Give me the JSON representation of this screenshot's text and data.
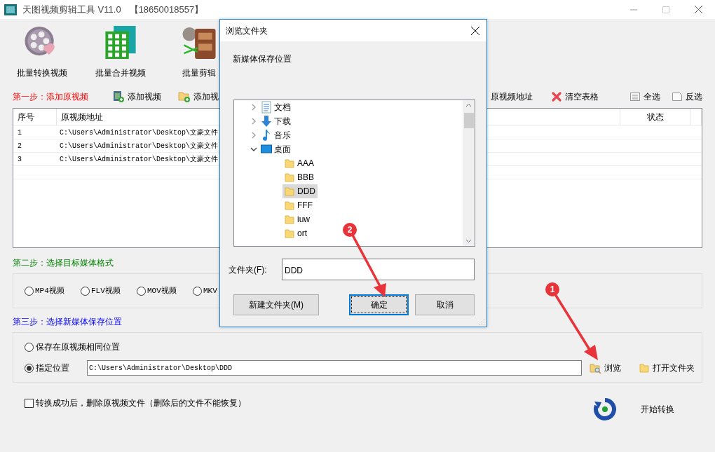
{
  "window": {
    "title": "天图视频剪辑工具 V11.0",
    "account": "【18650018557】"
  },
  "tools": [
    {
      "label": "批量转换视频",
      "kind": "convert"
    },
    {
      "label": "批量合并视频",
      "kind": "merge"
    },
    {
      "label": "批量剪辑",
      "kind": "cut"
    }
  ],
  "step1": {
    "label": "第一步：添加原视频",
    "actions_left": [
      {
        "label": "添加视频",
        "kind": "add-video"
      },
      {
        "label": "添加视",
        "kind": "add-folder"
      }
    ],
    "actions_right": [
      {
        "label": "原视频地址",
        "kind": "plain"
      },
      {
        "label": "清空表格",
        "kind": "clear"
      },
      {
        "label": "全选",
        "kind": "select-all"
      },
      {
        "label": "反选",
        "kind": "invert"
      }
    ]
  },
  "table": {
    "columns": [
      "序号",
      "原视频地址",
      "状态"
    ],
    "rows": [
      {
        "index": "1",
        "path": "C:\\Users\\Administrator\\Desktop\\文豪文件"
      },
      {
        "index": "2",
        "path": "C:\\Users\\Administrator\\Desktop\\文豪文件"
      },
      {
        "index": "3",
        "path": "C:\\Users\\Administrator\\Desktop\\文豪文件"
      }
    ]
  },
  "step2": {
    "label": "第二步：选择目标媒体格式",
    "formats": [
      {
        "label": "MP4视频",
        "selected": false
      },
      {
        "label": "FLV视频",
        "selected": false
      },
      {
        "label": "MOV视频",
        "selected": false
      },
      {
        "label": "MKV",
        "selected": false
      }
    ]
  },
  "step3": {
    "label": "第三步：选择新媒体保存位置",
    "options": [
      {
        "label": "保存在原视频相同位置",
        "selected": false
      },
      {
        "label": "指定位置",
        "selected": true
      }
    ],
    "path": "C:\\Users\\Administrator\\Desktop\\DDD",
    "browse": "浏览",
    "open_folder": "打开文件夹"
  },
  "delete_original": {
    "label": "转换成功后，删除原视频文件（删除后的文件不能恢复）",
    "checked": false
  },
  "start": "开始转换",
  "dialog": {
    "title": "浏览文件夹",
    "description": "新媒体保存位置",
    "tree": [
      {
        "label": "文档",
        "kind": "document",
        "expanded": false,
        "selected": false
      },
      {
        "label": "下载",
        "kind": "download",
        "expanded": false,
        "selected": false
      },
      {
        "label": "音乐",
        "kind": "music",
        "expanded": false,
        "selected": false
      },
      {
        "label": "桌面",
        "kind": "desktop",
        "expanded": true,
        "selected": false,
        "children": [
          {
            "label": "AAA",
            "kind": "folder",
            "selected": false
          },
          {
            "label": "BBB",
            "kind": "folder",
            "selected": false
          },
          {
            "label": "DDD",
            "kind": "folder",
            "selected": true
          },
          {
            "label": "FFF",
            "kind": "folder",
            "selected": false
          },
          {
            "label": "iuw",
            "kind": "folder",
            "selected": false
          },
          {
            "label": "ort",
            "kind": "folder",
            "selected": false
          }
        ]
      }
    ],
    "folder_label": "文件夹(F):",
    "folder_value": "DDD",
    "buttons": [
      {
        "label": "新建文件夹(M)",
        "kind": "default"
      },
      {
        "label": "确定",
        "kind": "primary"
      },
      {
        "label": "取消",
        "kind": "default"
      }
    ]
  },
  "annotations": [
    {
      "label": "1",
      "kind": "browse"
    },
    {
      "label": "2",
      "kind": "confirm"
    }
  ]
}
